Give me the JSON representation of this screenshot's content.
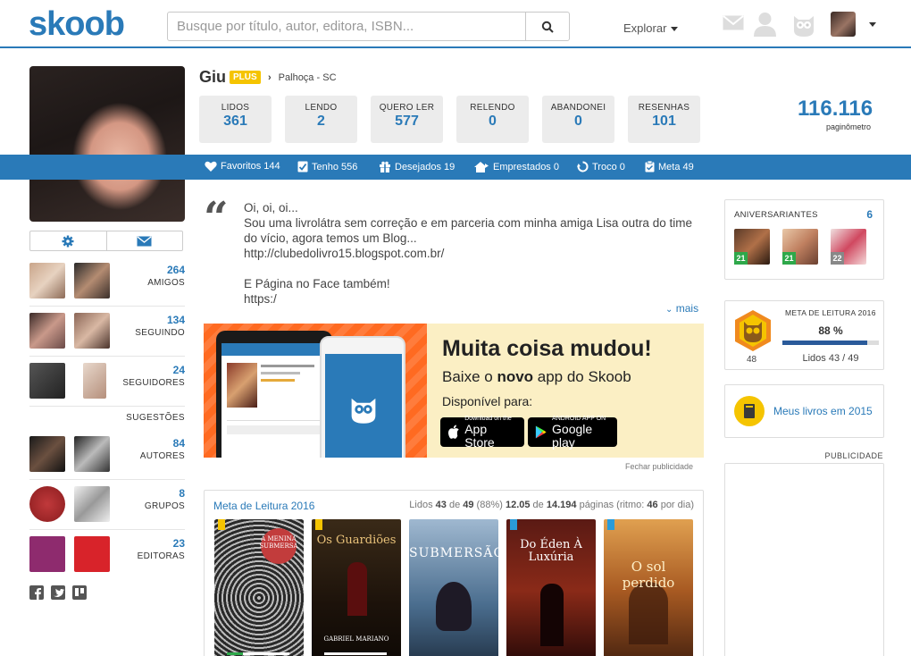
{
  "header": {
    "logo": "skoob",
    "search_placeholder": "Busque por título, autor, editora, ISBN...",
    "explorar": "Explorar",
    "brand_color": "#2a7ab8"
  },
  "profile": {
    "name": "Giu",
    "badge": "PLUS",
    "city": "Palhoça",
    "state": "SC",
    "loc_sep": "-",
    "stats": [
      {
        "label": "LIDOS",
        "value": "361"
      },
      {
        "label": "LENDO",
        "value": "2"
      },
      {
        "label": "QUERO LER",
        "value": "577"
      },
      {
        "label": "RELENDO",
        "value": "0"
      },
      {
        "label": "ABANDONEI",
        "value": "0"
      },
      {
        "label": "RESENHAS",
        "value": "101"
      }
    ],
    "paginometro": {
      "value": "116.116",
      "label": "paginômetro"
    }
  },
  "shelf_bar": [
    {
      "icon": "heart-icon",
      "label": "Favoritos 144"
    },
    {
      "icon": "check-icon",
      "label": "Tenho 556"
    },
    {
      "icon": "gift-icon",
      "label": "Desejados 19"
    },
    {
      "icon": "house-icon",
      "label": "Emprestados 0"
    },
    {
      "icon": "swap-icon",
      "label": "Troco 0"
    },
    {
      "icon": "clipboard-icon",
      "label": "Meta 49"
    }
  ],
  "sidebar": {
    "amigos": {
      "count": "264",
      "label": "AMIGOS"
    },
    "seguindo": {
      "count": "134",
      "label": "SEGUINDO"
    },
    "seguidores": {
      "count": "24",
      "label": "SEGUIDORES"
    },
    "sugestoes": "SUGESTÕES",
    "autores": {
      "count": "84",
      "label": "AUTORES"
    },
    "grupos": {
      "count": "8",
      "label": "GRUPOS"
    },
    "editoras": {
      "count": "23",
      "label": "EDITORAS"
    }
  },
  "bio": {
    "lines": [
      "Oi, oi, oi...",
      "Sou uma livrolátra sem correção e em parceria com minha amiga Lisa outra do time do vício, agora temos um Blog...",
      "http://clubedolivro15.blogspot.com.br/",
      "",
      "E Página no Face também!",
      "https:/"
    ],
    "more": "mais"
  },
  "ad": {
    "title": "Muita coisa mudou!",
    "subtitle_a": "Baixe o ",
    "subtitle_b": "novo",
    "subtitle_c": " app do Skoob",
    "available": "Disponível para:",
    "appstore_small": "Download on the",
    "appstore_big": "App Store",
    "gplay_small": "ANDROID APP ON",
    "gplay_big": "Google play",
    "close": "Fechar publicidade"
  },
  "meta": {
    "title": "Meta de Leitura 2016",
    "info_a": "Lidos ",
    "lidos": "43",
    "info_b": " de ",
    "total": "49",
    "info_c": " (88%) ",
    "meta_val": "12.05",
    "info_d": " de ",
    "pages": "14.194",
    "info_e": " páginas (ritmo: ",
    "ritmo": "46",
    "info_f": " por dia)",
    "books": [
      {
        "title": "A MENINA SUBMERSA"
      },
      {
        "title": "Os Guardiões",
        "author": "GABRIEL MARIANO"
      },
      {
        "title": "SUBMERSÃO"
      },
      {
        "title": "Do Éden À Luxúria"
      },
      {
        "title": "O sol perdido"
      }
    ]
  },
  "right": {
    "aniversariantes": {
      "label": "ANIVERSARIANTES",
      "count": "6",
      "days": [
        "21",
        "21",
        "22"
      ]
    },
    "goal": {
      "title": "META DE LEITURA 2016",
      "percent": "88 %",
      "fill_pct": 88,
      "count": "48",
      "lidos": "Lidos 43 / 49"
    },
    "meus_livros": "Meus livros em 2015",
    "publicidade": "PUBLICIDADE"
  }
}
